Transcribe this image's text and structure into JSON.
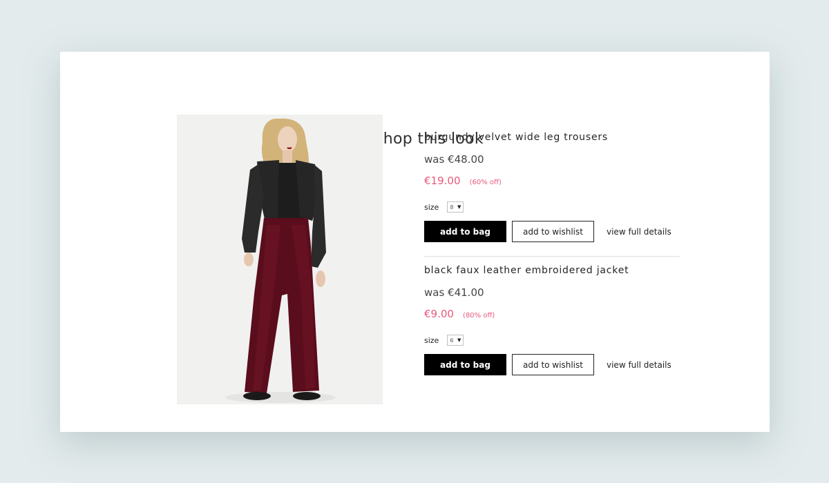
{
  "section": {
    "title": "shop this look",
    "icon": "hanger-icon"
  },
  "products": [
    {
      "name": "burgundy velvet wide leg trousers",
      "was_price": "was €48.00",
      "price": "€19.00",
      "discount": "(60% off)",
      "size_label": "size",
      "size_value": "8",
      "add_to_bag": "add to bag",
      "add_to_wishlist": "add to wishlist",
      "view_details": "view full details"
    },
    {
      "name": "black faux leather embroidered jacket",
      "was_price": "was €41.00",
      "price": "€9.00",
      "discount": "(80% off)",
      "size_label": "size",
      "size_value": "6",
      "add_to_bag": "add to bag",
      "add_to_wishlist": "add to wishlist",
      "view_details": "view full details"
    }
  ],
  "colors": {
    "sale": "#e8587b",
    "button_dark": "#000000",
    "page_background": "#e3ebec"
  }
}
